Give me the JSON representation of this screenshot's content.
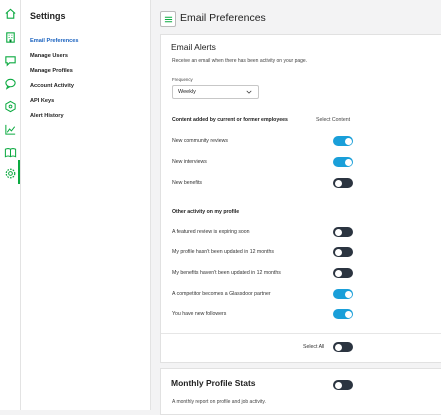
{
  "rail": {
    "icons": [
      "home-icon",
      "building-icon",
      "chat-bubble-icon",
      "chat-bubble-icon",
      "hexagon-network-icon",
      "line-chart-icon",
      "book-icon",
      "gear-icon"
    ]
  },
  "sidebar": {
    "title": "Settings",
    "items": [
      {
        "label": "Email Preferences",
        "active": true
      },
      {
        "label": "Manage Users",
        "active": false
      },
      {
        "label": "Manage Profiles",
        "active": false
      },
      {
        "label": "Account Activity",
        "active": false
      },
      {
        "label": "API Keys",
        "active": false
      },
      {
        "label": "Alert History",
        "active": false
      }
    ]
  },
  "header": {
    "title": "Email Preferences"
  },
  "email_alerts": {
    "title": "Email Alerts",
    "subtitle": "Receive an email when there has been activity on your page.",
    "frequency_label": "Frequency",
    "frequency_value": "Weekly",
    "section1": {
      "heading": "Content added by current or former employees",
      "select_content": "Select Content",
      "rows": [
        {
          "label": "New community reviews",
          "on": true
        },
        {
          "label": "New interviews",
          "on": true
        },
        {
          "label": "New benefits",
          "on": false
        }
      ]
    },
    "section2": {
      "heading": "Other activity on my profile",
      "rows": [
        {
          "label": "A featured review is expiring soon",
          "on": false
        },
        {
          "label": "My profile hasn't been updated in 12 months",
          "on": false
        },
        {
          "label": "My benefits haven't been updated in 12 months",
          "on": false
        },
        {
          "label": "A competitor becomes a Glassdoor partner",
          "on": true
        },
        {
          "label": "You have new followers",
          "on": true
        }
      ]
    },
    "select_all": {
      "label": "Select All",
      "on": false
    }
  },
  "monthly_stats": {
    "title": "Monthly Profile Stats",
    "subtitle": "A monthly report on profile and job activity.",
    "on": false
  },
  "colors": {
    "accent_green": "#0caa41",
    "link_blue": "#1861bf",
    "toggle_on": "#1a9fd9",
    "toggle_off": "#2b3440"
  }
}
